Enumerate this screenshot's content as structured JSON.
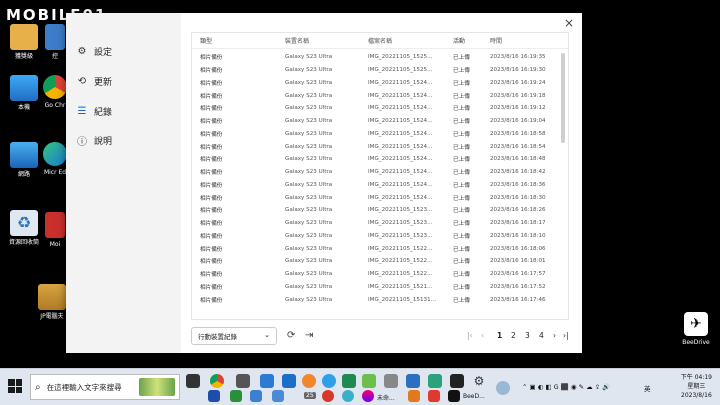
{
  "watermark": "MOBILE01",
  "desktop_icons": [
    {
      "name": "lottery-folder",
      "label": "獲獎級"
    },
    {
      "name": "control-panel",
      "label": "控"
    },
    {
      "name": "this-pc",
      "label": "本機"
    },
    {
      "name": "chrome",
      "label": "Go Chr"
    },
    {
      "name": "network",
      "label": "網路"
    },
    {
      "name": "edge",
      "label": "Micr Ed"
    },
    {
      "name": "recycle-bin",
      "label": "資源回收筒"
    },
    {
      "name": "moi",
      "label": "Moi"
    },
    {
      "name": "jp-folder",
      "label": "JP電腦夫"
    }
  ],
  "dialog": {
    "close_label": "×",
    "nav": [
      {
        "icon": "⚙",
        "label": "設定"
      },
      {
        "icon": "⟲",
        "label": "更新"
      },
      {
        "icon": "☰",
        "label": "紀錄"
      },
      {
        "icon": "ⓘ",
        "label": "說明"
      }
    ],
    "table": {
      "headers": [
        "類型",
        "裝置名稱",
        "檔案名稱",
        "活動",
        "時間"
      ],
      "rows": [
        [
          "相片備份",
          "Galaxy S23 Ultra",
          "IMG_20221105_1525...",
          "已上傳",
          "2023/8/16 16:19:35"
        ],
        [
          "相片備份",
          "Galaxy S23 Ultra",
          "IMG_20221105_1525...",
          "已上傳",
          "2023/8/16 16:19:30"
        ],
        [
          "相片備份",
          "Galaxy S23 Ultra",
          "IMG_20221105_1524...",
          "已上傳",
          "2023/8/16 16:19:24"
        ],
        [
          "相片備份",
          "Galaxy S23 Ultra",
          "IMG_20221105_1524...",
          "已上傳",
          "2023/8/16 16:19:18"
        ],
        [
          "相片備份",
          "Galaxy S23 Ultra",
          "IMG_20221105_1524...",
          "已上傳",
          "2023/8/16 16:19:12"
        ],
        [
          "相片備份",
          "Galaxy S23 Ultra",
          "IMG_20221105_1524...",
          "已上傳",
          "2023/8/16 16:19:04"
        ],
        [
          "相片備份",
          "Galaxy S23 Ultra",
          "IMG_20221105_1524...",
          "已上傳",
          "2023/8/16 16:18:58"
        ],
        [
          "相片備份",
          "Galaxy S23 Ultra",
          "IMG_20221105_1524...",
          "已上傳",
          "2023/8/16 16:18:54"
        ],
        [
          "相片備份",
          "Galaxy S23 Ultra",
          "IMG_20221105_1524...",
          "已上傳",
          "2023/8/16 16:18:48"
        ],
        [
          "相片備份",
          "Galaxy S23 Ultra",
          "IMG_20221105_1524...",
          "已上傳",
          "2023/8/16 16:18:42"
        ],
        [
          "相片備份",
          "Galaxy S23 Ultra",
          "IMG_20221105_1524...",
          "已上傳",
          "2023/8/16 16:18:36"
        ],
        [
          "相片備份",
          "Galaxy S23 Ultra",
          "IMG_20221105_1524...",
          "已上傳",
          "2023/8/16 16:18:30"
        ],
        [
          "相片備份",
          "Galaxy S23 Ultra",
          "IMG_20221105_1523...",
          "已上傳",
          "2023/8/16 16:18:26"
        ],
        [
          "相片備份",
          "Galaxy S23 Ultra",
          "IMG_20221105_1523...",
          "已上傳",
          "2023/8/16 16:18:17"
        ],
        [
          "相片備份",
          "Galaxy S23 Ultra",
          "IMG_20221105_1523...",
          "已上傳",
          "2023/8/16 16:18:10"
        ],
        [
          "相片備份",
          "Galaxy S23 Ultra",
          "IMG_20221105_1522...",
          "已上傳",
          "2023/8/16 16:18:06"
        ],
        [
          "相片備份",
          "Galaxy S23 Ultra",
          "IMG_20221105_1522...",
          "已上傳",
          "2023/8/16 16:18:01"
        ],
        [
          "相片備份",
          "Galaxy S23 Ultra",
          "IMG_20221105_1522...",
          "已上傳",
          "2023/8/16 16:17:57"
        ],
        [
          "相片備份",
          "Galaxy S23 Ultra",
          "IMG_20221105_1521...",
          "已上傳",
          "2023/8/16 16:17:52"
        ],
        [
          "相片備份",
          "Galaxy S23 Ultra",
          "IMG_20221105_15131...",
          "已上傳",
          "2023/8/16 16:17:46"
        ]
      ]
    },
    "footer": {
      "filter_value": "行動裝置紀錄",
      "pages": [
        "1",
        "2",
        "3",
        "4"
      ]
    }
  },
  "beedrive_label": "BeeDrive",
  "taskbar": {
    "search_placeholder": "在這裡輸入文字來搜尋",
    "active_app_label": "BeeD...",
    "other_app_label": "未命...",
    "badge_count": "25",
    "input_method": "英",
    "clock_time": "下午 04:19",
    "clock_day": "星期三",
    "clock_date": "2023/8/16"
  }
}
